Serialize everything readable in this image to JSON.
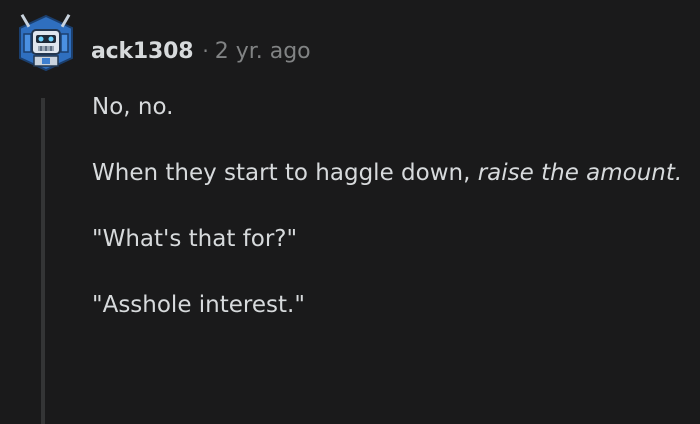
{
  "comment": {
    "username": "ack1308",
    "separator": "·",
    "timestamp": "2 yr. ago",
    "avatar_icon": "robot-avatar-icon",
    "paragraphs": {
      "p1": "No, no.",
      "p2_plain": "When they start to haggle down, ",
      "p2_italic": "raise the amount.",
      "p3": "\"What's that for?\"",
      "p4": "\"Asshole interest.\""
    }
  },
  "colors": {
    "background": "#1a1a1b",
    "text": "#d7dadc",
    "muted": "#818384",
    "thread_line": "#343536",
    "avatar_blue": "#3d7fd0"
  }
}
